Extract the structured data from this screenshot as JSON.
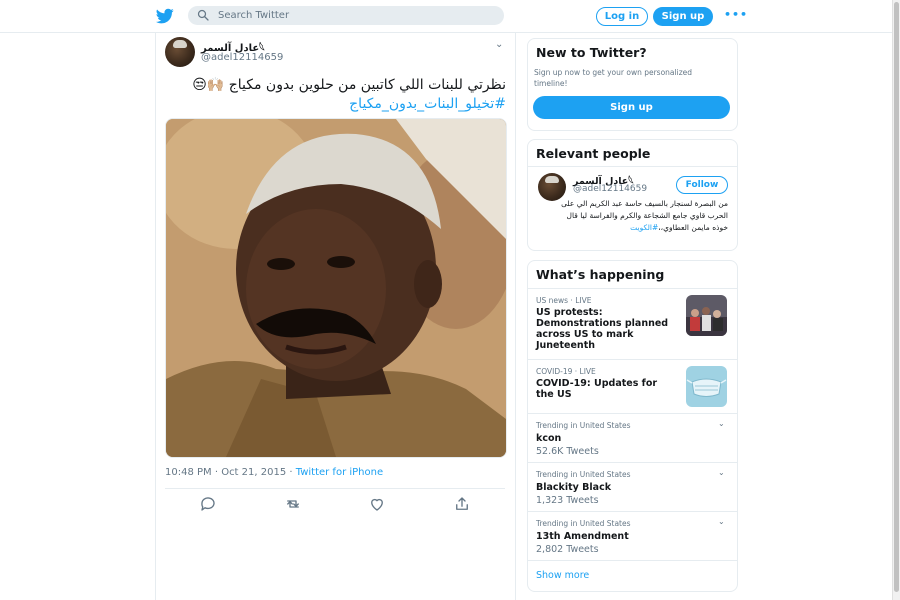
{
  "header": {
    "search_placeholder": "Search Twitter",
    "login_label": "Log in",
    "signup_label": "Sign up",
    "more_label": "•••"
  },
  "colors": {
    "accent": "#1da1f2",
    "muted": "#657786",
    "border": "#e6ecf0"
  },
  "tweet": {
    "display_name": "عادل آلسمر𓆩",
    "handle": "@adel12114659",
    "text": "نظرتي للبنات اللي كاتبين من حلوين بدون مكياج",
    "emoji": "🙌🏼😒",
    "hashtag": "#تخيلو_البنات_بدون_مكياج",
    "timestamp": "10:48 PM · Oct 21, 2015 · ",
    "source": "Twitter for iPhone",
    "actions": [
      "reply-icon",
      "retweet-icon",
      "like-icon",
      "share-icon"
    ]
  },
  "new_to_twitter": {
    "title": "New to Twitter?",
    "subtitle": "Sign up now to get your own personalized timeline!",
    "button": "Sign up"
  },
  "relevant_people": {
    "title": "Relevant people",
    "name": "عادل آلسمر𓆩",
    "handle": "@adel12114659",
    "follow_label": "Follow",
    "bio": "من البصرة لسنجار بالسيف حاسة عبد الكريم الي على الحرب قاوي جامع الشجاعة والكرم والفراسة ليا قال خوذه مايمن العطاوي،،",
    "bio_tag": "#الكويت"
  },
  "whats_happening": {
    "title": "What’s happening",
    "items": [
      {
        "meta": "US news · LIVE",
        "topic": "US protests: Demonstrations planned across US to mark Juneteenth",
        "count": ""
      },
      {
        "meta": "COVID-19 · LIVE",
        "topic": "COVID-19: Updates for the US",
        "count": ""
      },
      {
        "meta": "Trending in United States",
        "topic": "kcon",
        "count": "52.6K Tweets"
      },
      {
        "meta": "Trending in United States",
        "topic": "Blackity Black",
        "count": "1,323 Tweets"
      },
      {
        "meta": "Trending in United States",
        "topic": "13th Amendment",
        "count": "2,802 Tweets"
      }
    ],
    "show_more": "Show more"
  }
}
